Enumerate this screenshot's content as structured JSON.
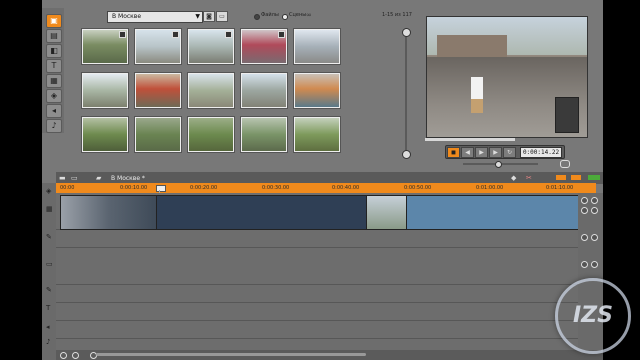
{
  "library": {
    "folder": "В Москве",
    "filter_files": "Файлы",
    "filter_scenes": "Сцены",
    "count": "1-15 из 117"
  },
  "transport": {
    "timecode": "0:00:14.22"
  },
  "timeline": {
    "project_name": "В Москве *",
    "ruler_ticks": [
      "00:00",
      "0:00:10.00",
      "0:00:20.00",
      "0:00:30.00",
      "0:00:40.00",
      "0:00:50.00",
      "0:01:00.00",
      "0:01:10.00"
    ]
  },
  "watermark": {
    "text": "IZS"
  },
  "colors": {
    "accent": "#f08a1c",
    "panel": "#787878",
    "clip_dark": "#2f3f55",
    "clip_light": "#5c86aa"
  }
}
